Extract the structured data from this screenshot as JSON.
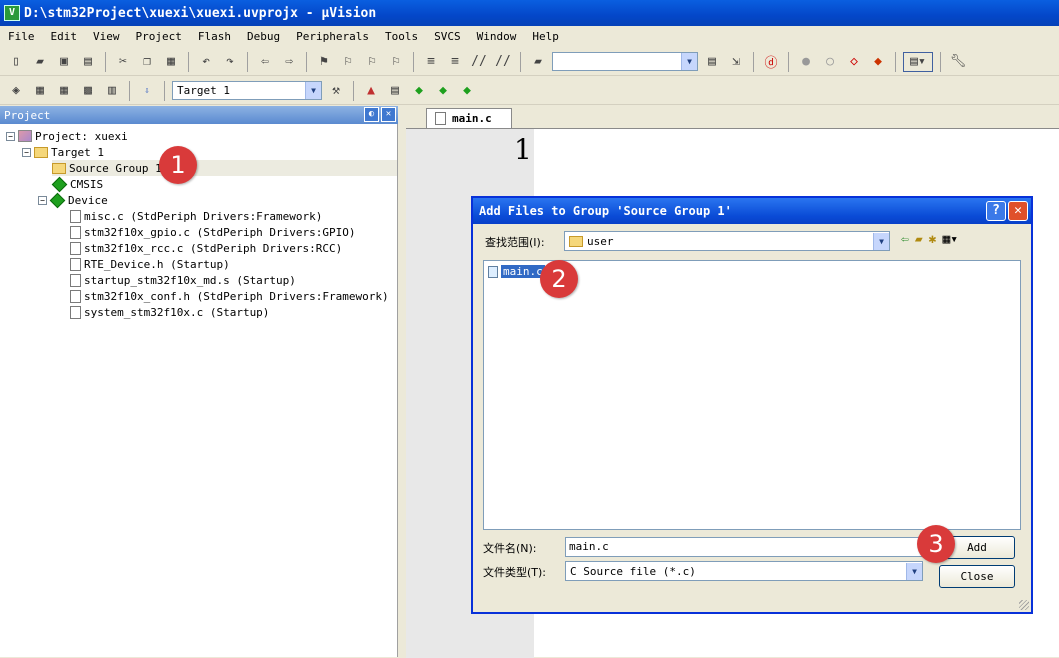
{
  "window": {
    "title": "D:\\stm32Project\\xuexi\\xuexi.uvprojx - μVision"
  },
  "menu": [
    "File",
    "Edit",
    "View",
    "Project",
    "Flash",
    "Debug",
    "Peripherals",
    "Tools",
    "SVCS",
    "Window",
    "Help"
  ],
  "toolbar2": {
    "target": "Target 1"
  },
  "project": {
    "title": "Project",
    "root": "Project: xuexi",
    "target": "Target 1",
    "group": "Source Group 1",
    "cmsis": "CMSIS",
    "device": "Device",
    "files": [
      "misc.c (StdPeriph Drivers:Framework)",
      "stm32f10x_gpio.c (StdPeriph Drivers:GPIO)",
      "stm32f10x_rcc.c (StdPeriph Drivers:RCC)",
      "RTE_Device.h (Startup)",
      "startup_stm32f10x_md.s (Startup)",
      "stm32f10x_conf.h (StdPeriph Drivers:Framework)",
      "system_stm32f10x.c (Startup)"
    ]
  },
  "editor": {
    "tab": "main.c",
    "line": "1"
  },
  "dialog": {
    "title": "Add Files to Group 'Source Group 1'",
    "lookin_label": "查找范围(I):",
    "lookin_value": "user",
    "files": [
      "main.c"
    ],
    "filename_label": "文件名(N):",
    "filename_value": "main.c",
    "filetype_label": "文件类型(T):",
    "filetype_value": "C Source file (*.c)",
    "add": "Add",
    "close": "Close"
  },
  "annotations": [
    "1",
    "2",
    "3"
  ],
  "colors": {
    "title_blue": "#0447c9",
    "badge_red": "#d93a3a",
    "selection": "#316ac5"
  }
}
